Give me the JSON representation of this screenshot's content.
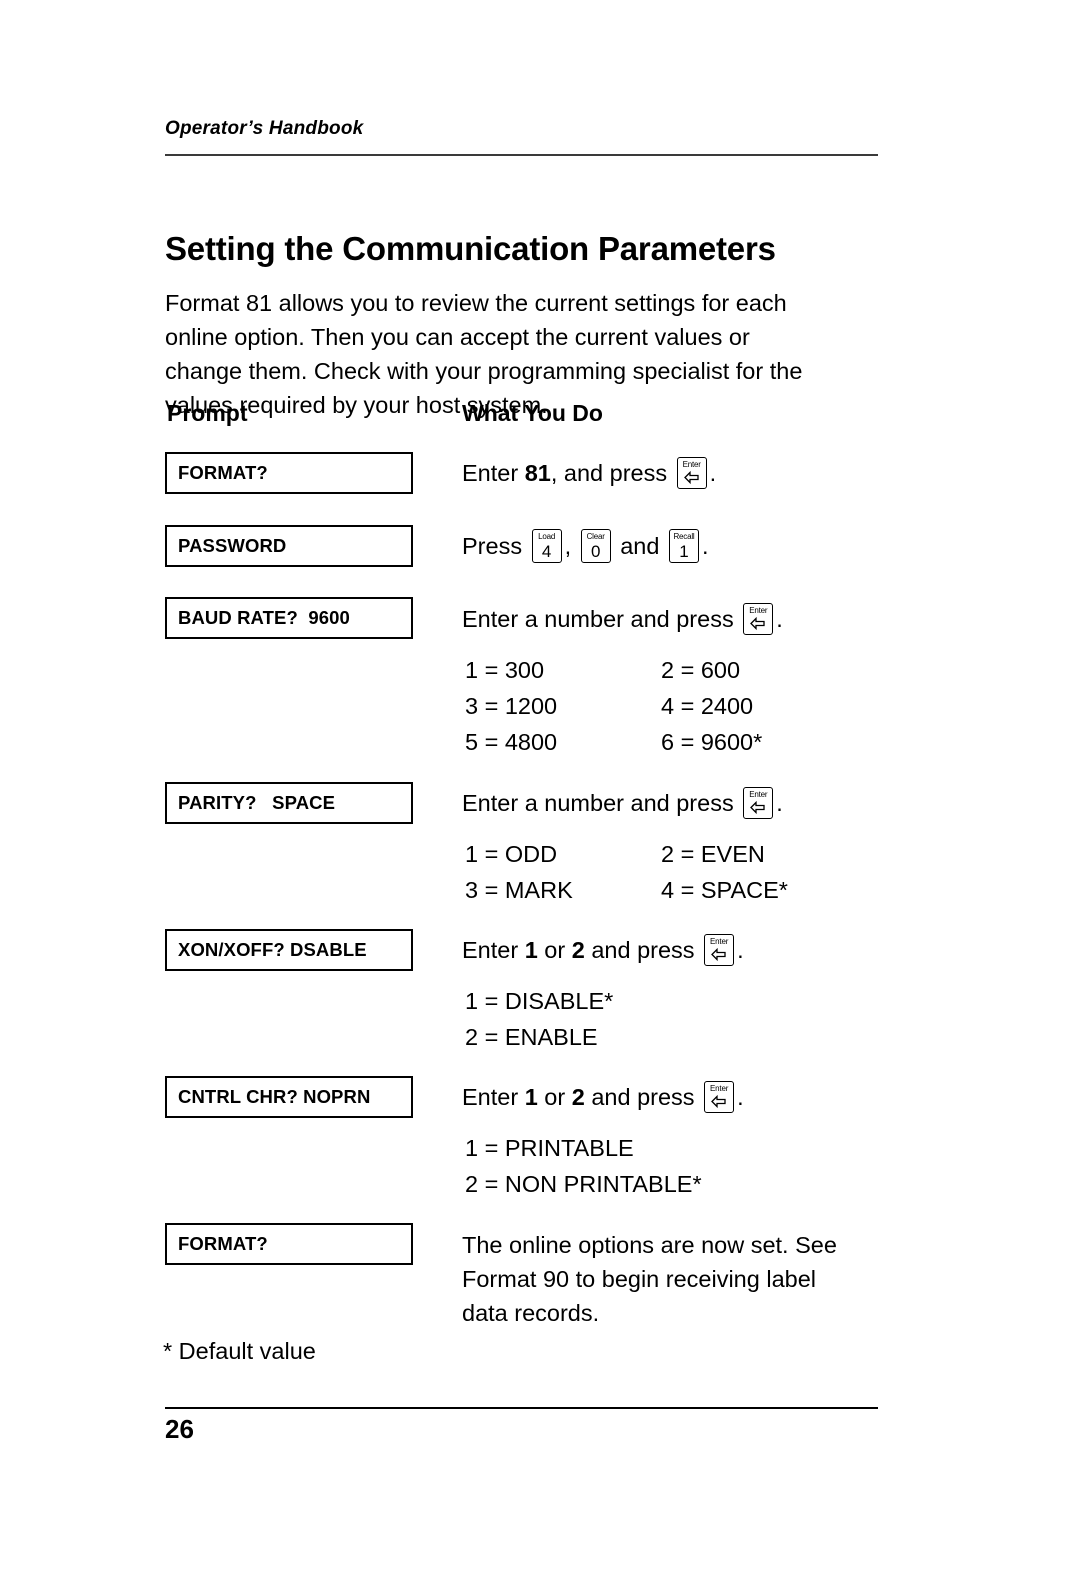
{
  "header": {
    "running_head": "Operator’s Handbook"
  },
  "title": "Setting the Communication Parameters",
  "intro": "Format 81 allows you to review the current settings for each\nonline option.  Then you can accept the current values or\nchange them.  Check with your programming specialist for the\nvalues required by your host system.",
  "columns": {
    "prompt": "Prompt",
    "what_you_do": "What You Do"
  },
  "keys": {
    "enter": {
      "cap": "Enter",
      "glyph": "enter-arrow-icon"
    },
    "load4": {
      "cap": "Load",
      "digit": "4"
    },
    "clear0": {
      "cap": "Clear",
      "digit": "0"
    },
    "recall1": {
      "cap": "Recall",
      "digit": "1"
    }
  },
  "rows": [
    {
      "prompt": "FORMAT?",
      "action_pre": "Enter ",
      "action_bold": "81",
      "action_mid": ", and press ",
      "action_post": ".",
      "options": []
    },
    {
      "prompt": "PASSWORD",
      "action_pre": "Press ",
      "action_sep1": ", ",
      "action_sep2": " and ",
      "action_post": ".",
      "options": []
    },
    {
      "prompt": "BAUD RATE?  9600",
      "action_pre": "Enter a number and press ",
      "action_post": ".",
      "options": [
        {
          "c1": "1 = 300",
          "c2": "2 = 600"
        },
        {
          "c1": "3 = 1200",
          "c2": "4 = 2400"
        },
        {
          "c1": "5 = 4800",
          "c2": "6 = 9600*"
        }
      ]
    },
    {
      "prompt": "PARITY?   SPACE",
      "action_pre": "Enter a number and press ",
      "action_post": ".",
      "options": [
        {
          "c1": "1 = ODD",
          "c2": "2 = EVEN"
        },
        {
          "c1": "3 = MARK",
          "c2": "4 = SPACE*"
        }
      ]
    },
    {
      "prompt": "XON/XOFF? DSABLE",
      "action_pre": "Enter ",
      "action_bold": "1",
      "action_mid": " or ",
      "action_bold2": "2",
      "action_mid2": " and press ",
      "action_post": ".",
      "options": [
        {
          "c1": "1 = DISABLE*"
        },
        {
          "c1": "2 = ENABLE"
        }
      ]
    },
    {
      "prompt": "CNTRL CHR? NOPRN",
      "action_pre": "Enter ",
      "action_bold": "1",
      "action_mid": " or ",
      "action_bold2": "2",
      "action_mid2": " and press ",
      "action_post": ".",
      "options": [
        {
          "c1": "1 = PRINTABLE"
        },
        {
          "c1": "2 = NON PRINTABLE*"
        }
      ]
    },
    {
      "prompt": "FORMAT?",
      "action_block": "The online options are now set.  See\nFormat 90 to begin receiving label\ndata records.",
      "options": []
    }
  ],
  "footnote": "* Default value",
  "footer": {
    "page_number": "26"
  }
}
